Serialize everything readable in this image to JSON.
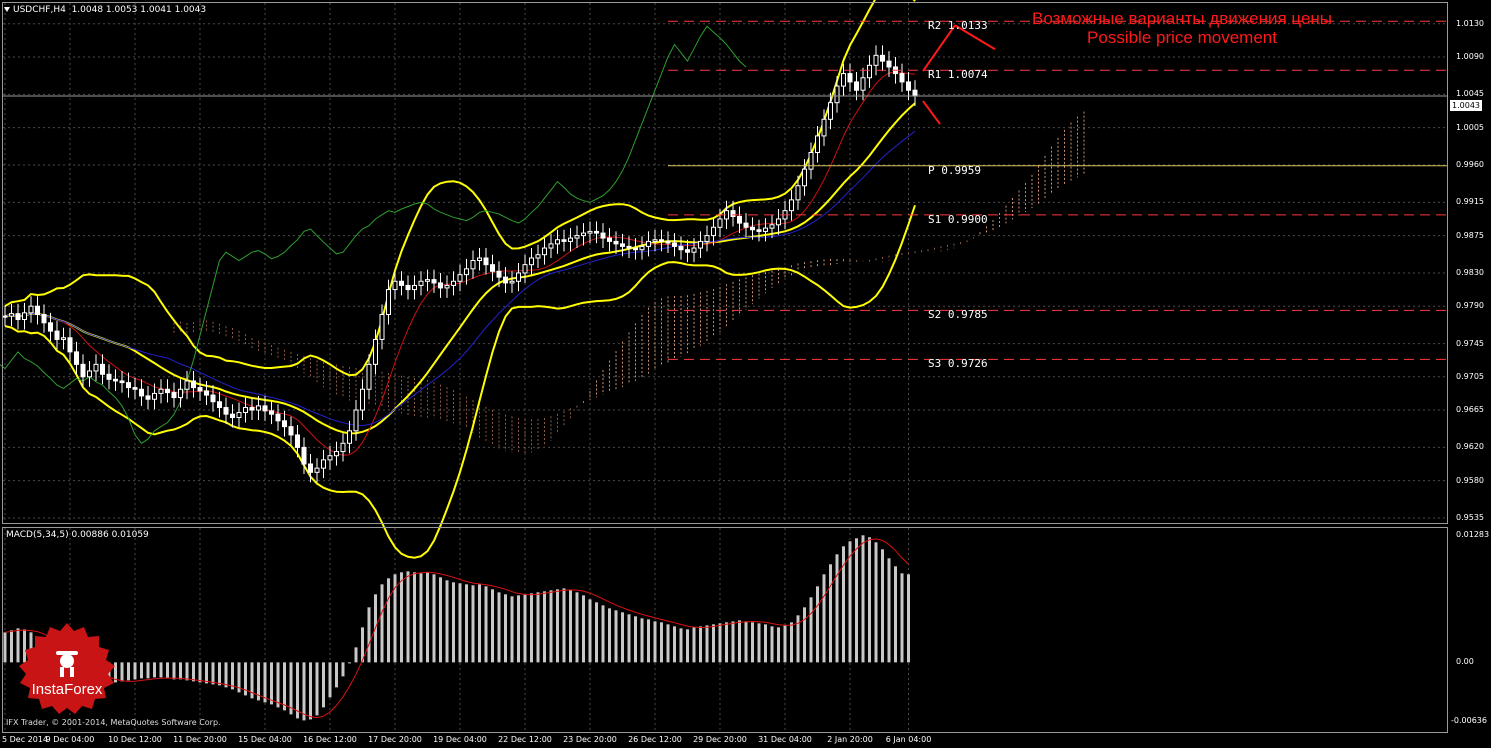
{
  "window": {
    "title": "USDCHF,H4",
    "ohlc": "1.0048 1.0053 1.0041 1.0043"
  },
  "colors": {
    "background": "#000000",
    "grid": "#4a4a4a",
    "pane_border": "#9a9a9a",
    "forecast_text": "#ff1a1a",
    "bollinger": "#ffff00",
    "pivot_line": "#d9c45a",
    "chikou": "#2f9e2f",
    "tenkan": "#cc1111",
    "kijun": "#2222cc",
    "cloud_bear": "#8b5a43",
    "cloud_bull": "#c89070",
    "macd_hist": "#c8c8c8",
    "macd_signal": "#dd1111"
  },
  "forecast": {
    "line1": "Возможные варианты движения цены",
    "line2": "Possible price movement"
  },
  "levels": [
    {
      "name": "R2",
      "text": "R2 1.0133",
      "value": 1.0133,
      "style": "dashed",
      "color": "#ff3b3b"
    },
    {
      "name": "R1",
      "text": "R1 1.0074",
      "value": 1.0074,
      "style": "dashed",
      "color": "#ff3b3b"
    },
    {
      "name": "P",
      "text": "P 0.9959",
      "value": 0.9959,
      "style": "solid",
      "color": "#d9c45a"
    },
    {
      "name": "S1",
      "text": "S1 0.9900",
      "value": 0.99,
      "style": "dashed",
      "color": "#ff3b3b"
    },
    {
      "name": "S2",
      "text": "S2 0.9785",
      "value": 0.9785,
      "style": "dashed",
      "color": "#ff3b3b"
    },
    {
      "name": "S3",
      "text": "S3 0.9726",
      "value": 0.9726,
      "style": "dashed",
      "color": "#ff3b3b"
    }
  ],
  "current_price": "1.0043",
  "macd": {
    "label": "MACD(5,34,5) 0.00886 0.01059",
    "ticks": [
      "0.01283",
      "0.00",
      "-0.00636"
    ]
  },
  "watermark": {
    "footer": "IFX Trader, © 2001-2014, MetaQuotes Software Corp.",
    "logo": "InstaForex"
  },
  "chart_data": [
    {
      "type": "candlestick",
      "title": "USDCHF,H4",
      "ylim": [
        0.9529,
        1.0155
      ],
      "yticks": [
        "1.0130",
        "1.0090",
        "1.0045",
        "1.0005",
        "0.9960",
        "0.9915",
        "0.9875",
        "0.9830",
        "0.9790",
        "0.9745",
        "0.9705",
        "0.9665",
        "0.9620",
        "0.9580",
        "0.9535"
      ],
      "ytick_values": [
        1.013,
        1.009,
        1.0045,
        1.0005,
        0.996,
        0.9915,
        0.9875,
        0.983,
        0.979,
        0.9745,
        0.9705,
        0.9665,
        0.962,
        0.958,
        0.9535
      ],
      "xticks": [
        "5 Dec 2014",
        "9 Dec 04:00",
        "10 Dec 12:00",
        "11 Dec 20:00",
        "15 Dec 04:00",
        "16 Dec 12:00",
        "17 Dec 20:00",
        "19 Dec 04:00",
        "22 Dec 12:00",
        "23 Dec 20:00",
        "26 Dec 12:00",
        "29 Dec 20:00",
        "31 Dec 04:00",
        "2 Jan 20:00",
        "6 Jan 04:00"
      ],
      "xtick_bar_index": [
        0,
        10,
        20,
        30,
        40,
        50,
        60,
        70,
        80,
        90,
        100,
        110,
        120,
        130,
        139
      ],
      "close_series": [
        0.9778,
        0.9781,
        0.9774,
        0.9782,
        0.979,
        0.978,
        0.977,
        0.976,
        0.975,
        0.9752,
        0.9735,
        0.972,
        0.9705,
        0.9712,
        0.972,
        0.9708,
        0.9702,
        0.97,
        0.9698,
        0.9692,
        0.969,
        0.9682,
        0.9678,
        0.9685,
        0.969,
        0.9686,
        0.968,
        0.969,
        0.97,
        0.9692,
        0.9688,
        0.9683,
        0.9675,
        0.9668,
        0.966,
        0.9656,
        0.9662,
        0.9668,
        0.9665,
        0.967,
        0.9664,
        0.966,
        0.9652,
        0.9645,
        0.9635,
        0.962,
        0.96,
        0.959,
        0.9595,
        0.9605,
        0.961,
        0.9615,
        0.9625,
        0.964,
        0.9665,
        0.969,
        0.972,
        0.975,
        0.978,
        0.981,
        0.982,
        0.9815,
        0.981,
        0.9815,
        0.982,
        0.9822,
        0.9818,
        0.9812,
        0.9815,
        0.982,
        0.9828,
        0.9835,
        0.9845,
        0.9848,
        0.984,
        0.9832,
        0.9825,
        0.9818,
        0.982,
        0.983,
        0.984,
        0.9848,
        0.9852,
        0.986,
        0.9865,
        0.987,
        0.9868,
        0.9872,
        0.9875,
        0.9878,
        0.988,
        0.9878,
        0.9872,
        0.9868,
        0.9865,
        0.9862,
        0.986,
        0.9858,
        0.9862,
        0.9868,
        0.987,
        0.9868,
        0.9866,
        0.9862,
        0.9858,
        0.9855,
        0.986,
        0.9868,
        0.9875,
        0.9885,
        0.9895,
        0.9905,
        0.9898,
        0.989,
        0.9885,
        0.9882,
        0.988,
        0.9884,
        0.9888,
        0.9895,
        0.9905,
        0.9918,
        0.9935,
        0.9955,
        0.9975,
        0.9995,
        1.0015,
        1.0035,
        1.0055,
        1.007,
        1.006,
        1.005,
        1.0065,
        1.008,
        1.0092,
        1.0085,
        1.0078,
        1.007,
        1.006,
        1.005,
        1.0043
      ],
      "macd_series": [
        0.003,
        0.0032,
        0.0034,
        0.0033,
        0.003,
        0.0025,
        0.002,
        0.0014,
        0.0008,
        0.0004,
        0.0,
        -0.0004,
        -0.0008,
        -0.0012,
        -0.0015,
        -0.0018,
        -0.002,
        -0.002,
        -0.0019,
        -0.0018,
        -0.0017,
        -0.0016,
        -0.0016,
        -0.0015,
        -0.0015,
        -0.0016,
        -0.0017,
        -0.0017,
        -0.0018,
        -0.0019,
        -0.002,
        -0.0021,
        -0.0022,
        -0.0023,
        -0.0025,
        -0.0027,
        -0.003,
        -0.0033,
        -0.0036,
        -0.0038,
        -0.004,
        -0.0042,
        -0.0045,
        -0.0048,
        -0.0052,
        -0.0056,
        -0.0058,
        -0.0057,
        -0.0053,
        -0.0045,
        -0.0035,
        -0.0025,
        -0.0014,
        0.0,
        0.0015,
        0.0035,
        0.0055,
        0.0068,
        0.0078,
        0.0084,
        0.0088,
        0.009,
        0.0091,
        0.009,
        0.0089,
        0.009,
        0.0088,
        0.0085,
        0.0082,
        0.008,
        0.0079,
        0.0078,
        0.0077,
        0.0078,
        0.0076,
        0.0073,
        0.007,
        0.0068,
        0.0066,
        0.0067,
        0.0068,
        0.0069,
        0.007,
        0.0071,
        0.0072,
        0.0073,
        0.0074,
        0.0072,
        0.007,
        0.0067,
        0.0063,
        0.006,
        0.0057,
        0.0054,
        0.0052,
        0.005,
        0.0048,
        0.0046,
        0.0044,
        0.0043,
        0.0041,
        0.004,
        0.0038,
        0.0036,
        0.0034,
        0.0033,
        0.0035,
        0.0036,
        0.0037,
        0.0038,
        0.0039,
        0.004,
        0.0041,
        0.0042,
        0.0041,
        0.004,
        0.0039,
        0.0038,
        0.0036,
        0.0035,
        0.0037,
        0.004,
        0.0047,
        0.0055,
        0.0065,
        0.0076,
        0.0088,
        0.0098,
        0.0108,
        0.0116,
        0.0121,
        0.0124,
        0.0127,
        0.0125,
        0.012,
        0.0113,
        0.0104,
        0.0096,
        0.0089,
        0.0088
      ]
    }
  ]
}
